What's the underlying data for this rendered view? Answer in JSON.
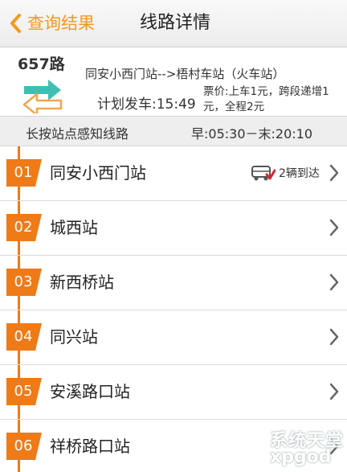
{
  "navbar": {
    "back_label": "查询结果",
    "title": "线路详情"
  },
  "route": {
    "number": "657路",
    "stations": "同安小西门站-->梧村车站（火车站）",
    "departure": "计划发车:15:49",
    "fare": "票价:上车1元，跨段递增1元，全程2元"
  },
  "hint": {
    "text": "长按站点感知线路",
    "hours": "早:05:30－末:20:10"
  },
  "stops": [
    {
      "num": "01",
      "name": "同安小西门站",
      "arrival": "2辆到达"
    },
    {
      "num": "02",
      "name": "城西站"
    },
    {
      "num": "03",
      "name": "新西桥站"
    },
    {
      "num": "04",
      "name": "同兴站"
    },
    {
      "num": "05",
      "name": "安溪路口站"
    },
    {
      "num": "06",
      "name": "祥桥路口站"
    }
  ],
  "watermark": {
    "site": "系统天堂",
    "domain": "xpgod"
  },
  "colors": {
    "accent": "#f39a1f",
    "badge": "#ef7a18",
    "swap_teal": "#3fbfb2"
  },
  "icons": [
    "chevron-left-icon",
    "swap-arrows-icon",
    "bus-check-icon",
    "chevron-right-icon"
  ]
}
